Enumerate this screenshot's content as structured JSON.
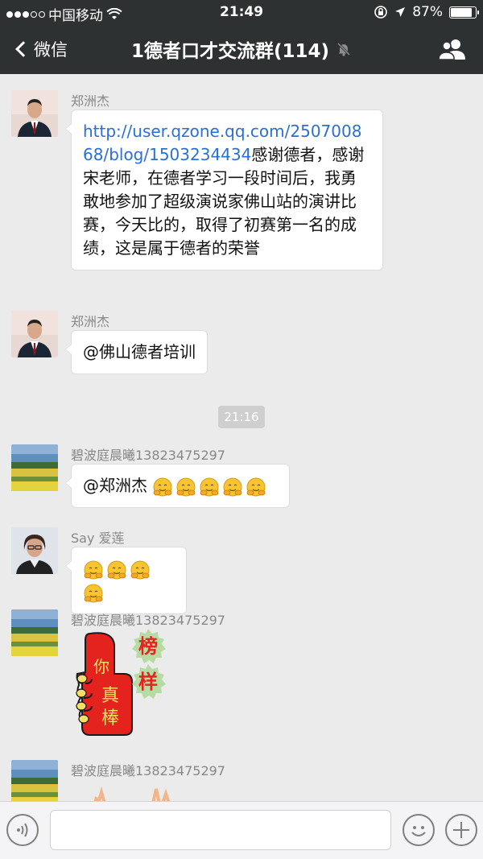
{
  "status_bar": {
    "carrier": "中国移动",
    "time": "21:49",
    "battery_text": "87%",
    "battery_level": 0.87
  },
  "nav": {
    "back_label": "微信",
    "title": "1德者口才交流群(114)"
  },
  "messages": [
    {
      "sender": "郑洲杰",
      "link_text": "http://user.qzone.qq.com/250700868/blog/1503234434",
      "text": "感谢德者，感谢宋老师，在德者学习一段时间后，我勇敢地参加了超级演说家佛山站的演讲比赛，今天比的，取得了初赛第一名的成绩，这是属于德者的荣誉"
    },
    {
      "sender": "郑洲杰",
      "text": "@佛山德者培训"
    },
    {
      "time_chip": "21:16"
    },
    {
      "sender": "碧波庭晨曦13823475297",
      "text": "@郑洲杰 ",
      "emoji_count": 5
    },
    {
      "sender": "Say 爱莲",
      "emoji_count": 4
    },
    {
      "sender": "碧波庭晨曦13823475297",
      "sticker": {
        "hand_text": "你真棒",
        "badge_chars": [
          "榜",
          "样"
        ]
      }
    },
    {
      "sender": "碧波庭晨曦13823475297"
    }
  ],
  "colors": {
    "nav_bg": "#2e3132",
    "chat_bg": "#ebebeb",
    "link": "#2a6fd6",
    "sticker_red": "#e4231f"
  }
}
